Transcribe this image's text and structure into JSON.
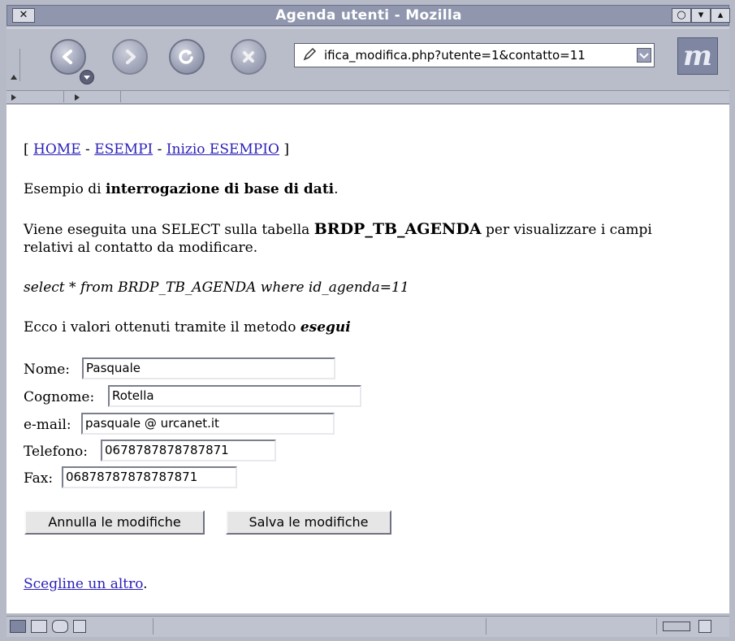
{
  "window": {
    "title": "Agenda utenti - Mozilla",
    "close_label": "✕",
    "buttons_right": [
      "○",
      "▾",
      "▴"
    ]
  },
  "toolbar": {
    "url": "ifica_modifica.php?utente=1&contatto=11",
    "logo_text": "m"
  },
  "nav": {
    "open_bracket": "[",
    "home": "HOME",
    "sep1": "-",
    "esempi": "ESEMPI",
    "sep2": "-",
    "inizio": "Inizio ESEMPIO",
    "close_bracket": "]"
  },
  "body": {
    "p1_prefix": "Esempio di ",
    "p1_bold": "interrogazione di base di dati",
    "p1_suffix": ".",
    "p2_prefix": "Viene eseguita una SELECT sulla tabella ",
    "p2_bold": "BRDP_TB_AGENDA",
    "p2_suffix": " per visualizzare i campi",
    "p2_line2": "relativi al contatto da modificare.",
    "query": "select * from BRDP_TB_AGENDA where id_agenda=11",
    "p4_prefix": "Ecco i valori ottenuti tramite il metodo ",
    "p4_bolditalic": "esegui"
  },
  "form": {
    "nome_label": "Nome:",
    "nome_value": "Pasquale",
    "cognome_label": "Cognome:",
    "cognome_value": "Rotella",
    "email_label": "e-mail:",
    "email_value": "pasquale @ urcanet.it",
    "telefono_label": "Telefono:",
    "telefono_value": "0678787878787871",
    "fax_label": "Fax:",
    "fax_value": "06878787878787871",
    "annulla_label": "Annulla le modifiche",
    "salva_label": "Salva le modifiche"
  },
  "footer_link": {
    "text": "Scegline un altro",
    "suffix": "."
  },
  "icons": {
    "back": "back-icon",
    "forward": "forward-icon",
    "reload": "reload-icon",
    "stop": "stop-icon"
  }
}
